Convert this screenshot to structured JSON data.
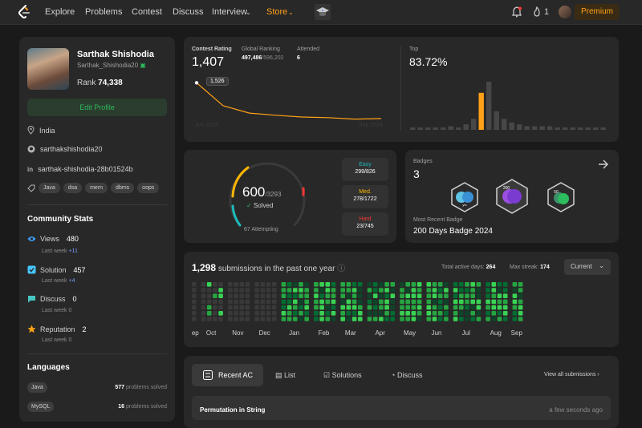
{
  "nav": {
    "links": [
      "Explore",
      "Problems",
      "Contest",
      "Discuss",
      "Interview",
      "Store"
    ],
    "flame_count": "1",
    "premium_label": "Premium"
  },
  "profile": {
    "name": "Sarthak Shishodia",
    "handle": "Sarthak_Shishodia20",
    "rank_label": "Rank",
    "rank_value": "74,338",
    "edit_label": "Edit Profile",
    "location": "India",
    "github": "sarthakshishodia20",
    "linkedin": "sarthak-shishodia-28b01524b",
    "skills": [
      "Java",
      "dsa",
      "mern",
      "dbms",
      "oops"
    ]
  },
  "community": {
    "title": "Community Stats",
    "items": [
      {
        "label": "Views",
        "value": "480",
        "lastweek_label": "Last week",
        "delta": "+11",
        "icon": "eye-icon",
        "color": "#3b9cf6"
      },
      {
        "label": "Solution",
        "value": "457",
        "lastweek_label": "Last week",
        "delta": "+4",
        "icon": "solution-check-icon",
        "color": "#46c6ff"
      },
      {
        "label": "Discuss",
        "value": "0",
        "lastweek_label": "Last week",
        "delta": "0",
        "icon": "discuss-bubble-icon",
        "color": "#46c6c2"
      },
      {
        "label": "Reputation",
        "value": "2",
        "lastweek_label": "Last week",
        "delta": "0",
        "icon": "star-icon",
        "color": "#ffa116"
      }
    ]
  },
  "languages": {
    "title": "Languages",
    "items": [
      {
        "name": "Java",
        "count": "577",
        "suffix": "problems solved"
      },
      {
        "name": "MySQL",
        "count": "16",
        "suffix": "problems solved"
      }
    ]
  },
  "contest": {
    "rating_label": "Contest Rating",
    "rating": "1,407",
    "global_label": "Global Ranking",
    "global_rank": "497,486",
    "global_total": "/596,202",
    "attended_label": "Attended",
    "attended": "6",
    "top_label": "Top",
    "top_value": "83.72%",
    "tooltip": "1,526",
    "x_start": "Jun 2024",
    "x_end": "Sep 2024",
    "line_points": [
      1526,
      1450,
      1425,
      1418,
      1412,
      1410,
      1405,
      1407
    ],
    "histogram": [
      1,
      1,
      1,
      1,
      1,
      2,
      1,
      3,
      6,
      20,
      26,
      10,
      6,
      4,
      3,
      2,
      2,
      2,
      2,
      1,
      1,
      1,
      1,
      1,
      1,
      1
    ],
    "highlight_index": 9,
    "colors": {
      "line": "#ffa116",
      "highlight": "#ffa116",
      "bar": "#474747"
    }
  },
  "solved": {
    "count": "600",
    "total": "/3293",
    "solved_label": "Solved",
    "attempting": "67 Attempting",
    "levels": [
      {
        "label": "Easy",
        "value": "299/826",
        "color": "#1cbaba"
      },
      {
        "label": "Med.",
        "value": "278/1722",
        "color": "#ffb700"
      },
      {
        "label": "Hard",
        "value": "23/745",
        "color": "#f63737"
      }
    ]
  },
  "badges": {
    "label": "Badges",
    "count": "3",
    "recent_label": "Most Recent Badge",
    "recent_name": "200 Days Badge 2024",
    "items": [
      {
        "icon": "badge-annual-icon",
        "text": "yrs"
      },
      {
        "icon": "badge-200-days-icon",
        "text": "200"
      },
      {
        "icon": "badge-50-days-icon",
        "text": "50"
      }
    ]
  },
  "submissions": {
    "count": "1,298",
    "label": "submissions in the past one year",
    "active_label": "Total active days:",
    "active_days": "264",
    "streak_label": "Max streak:",
    "streak": "174",
    "dropdown": "Current",
    "months": [
      "Sep",
      "Oct",
      "Nov",
      "Dec",
      "Jan",
      "Feb",
      "Mar",
      "Apr",
      "May",
      "Jun",
      "Jul",
      "Aug",
      "Sep"
    ],
    "weeks_per_month": [
      1,
      4,
      4,
      4,
      5,
      4,
      4,
      5,
      4,
      4,
      5,
      4,
      2
    ],
    "level_colors": [
      "#393939",
      "#0e4429",
      "#006d32",
      "#26a641",
      "#39d353"
    ]
  },
  "activity": {
    "tabs": [
      "Recent AC",
      "List",
      "Solutions",
      "Discuss"
    ],
    "view_all": "View all submissions",
    "first_item": "Permutation in String",
    "first_time": "a few seconds ago"
  }
}
